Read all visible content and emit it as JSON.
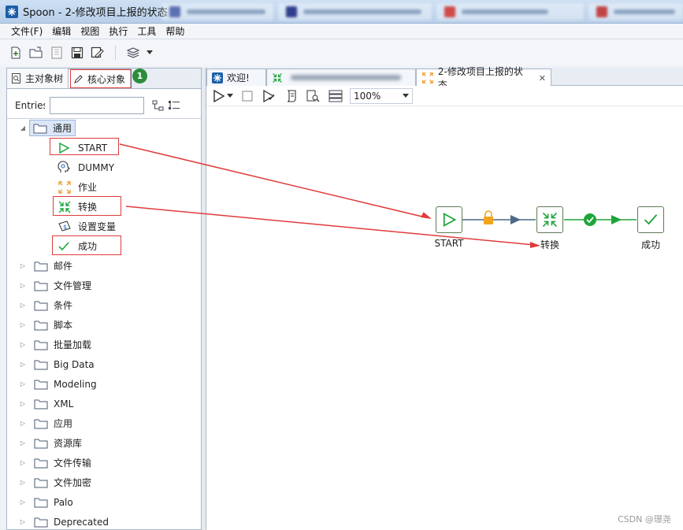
{
  "window": {
    "title": "Spoon - 2-修改项目上报的状态"
  },
  "menu": {
    "items": [
      "文件(F)",
      "编辑",
      "视图",
      "执行",
      "工具",
      "帮助"
    ]
  },
  "left_panel": {
    "tabs": [
      {
        "label": "主对象树",
        "icon": "search-doc-icon"
      },
      {
        "label": "核心对象",
        "icon": "pencil-icon"
      }
    ],
    "badge": "1",
    "entries_label": "Entries",
    "entries_value": "",
    "tree": {
      "root": "通用",
      "children": [
        {
          "label": "START",
          "icon": "start-play-icon"
        },
        {
          "label": "DUMMY",
          "icon": "dummy-head-icon"
        },
        {
          "label": "作业",
          "icon": "job-arrows-icon"
        },
        {
          "label": "转换",
          "icon": "transform-arrows-icon"
        },
        {
          "label": "设置变量",
          "icon": "set-variable-icon"
        },
        {
          "label": "成功",
          "icon": "success-check-icon"
        }
      ],
      "categories": [
        "邮件",
        "文件管理",
        "条件",
        "脚本",
        "批量加载",
        "Big Data",
        "Modeling",
        "XML",
        "应用",
        "资源库",
        "文件传输",
        "文件加密",
        "Palo",
        "Deprecated"
      ]
    }
  },
  "editor": {
    "tabs": [
      {
        "label": "欢迎!",
        "icon": "spoon-icon"
      },
      {
        "label": "",
        "icon": "transform-arrows-icon"
      },
      {
        "label": "2-修改项目上报的状态",
        "icon": "job-arrows-icon"
      }
    ],
    "zoom": "100%"
  },
  "flow": {
    "nodes": [
      {
        "label": "START",
        "icon": "start-play-icon"
      },
      {
        "label": "转换",
        "icon": "transform-arrows-icon"
      },
      {
        "label": "成功",
        "icon": "success-check-icon"
      }
    ],
    "hops": [
      {
        "from": "START",
        "to": "转换",
        "condition": "unconditional",
        "marker": "lock-icon",
        "color": "#4a6a86"
      },
      {
        "from": "转换",
        "to": "成功",
        "condition": "success",
        "marker": "check-circle-icon",
        "color": "#1ea53a"
      }
    ]
  },
  "colors": {
    "annotation_red": "#e03b3b",
    "badge_green": "#2e8b3d",
    "node_green": "#1ea53a"
  },
  "watermark": "CSDN @璟尧"
}
